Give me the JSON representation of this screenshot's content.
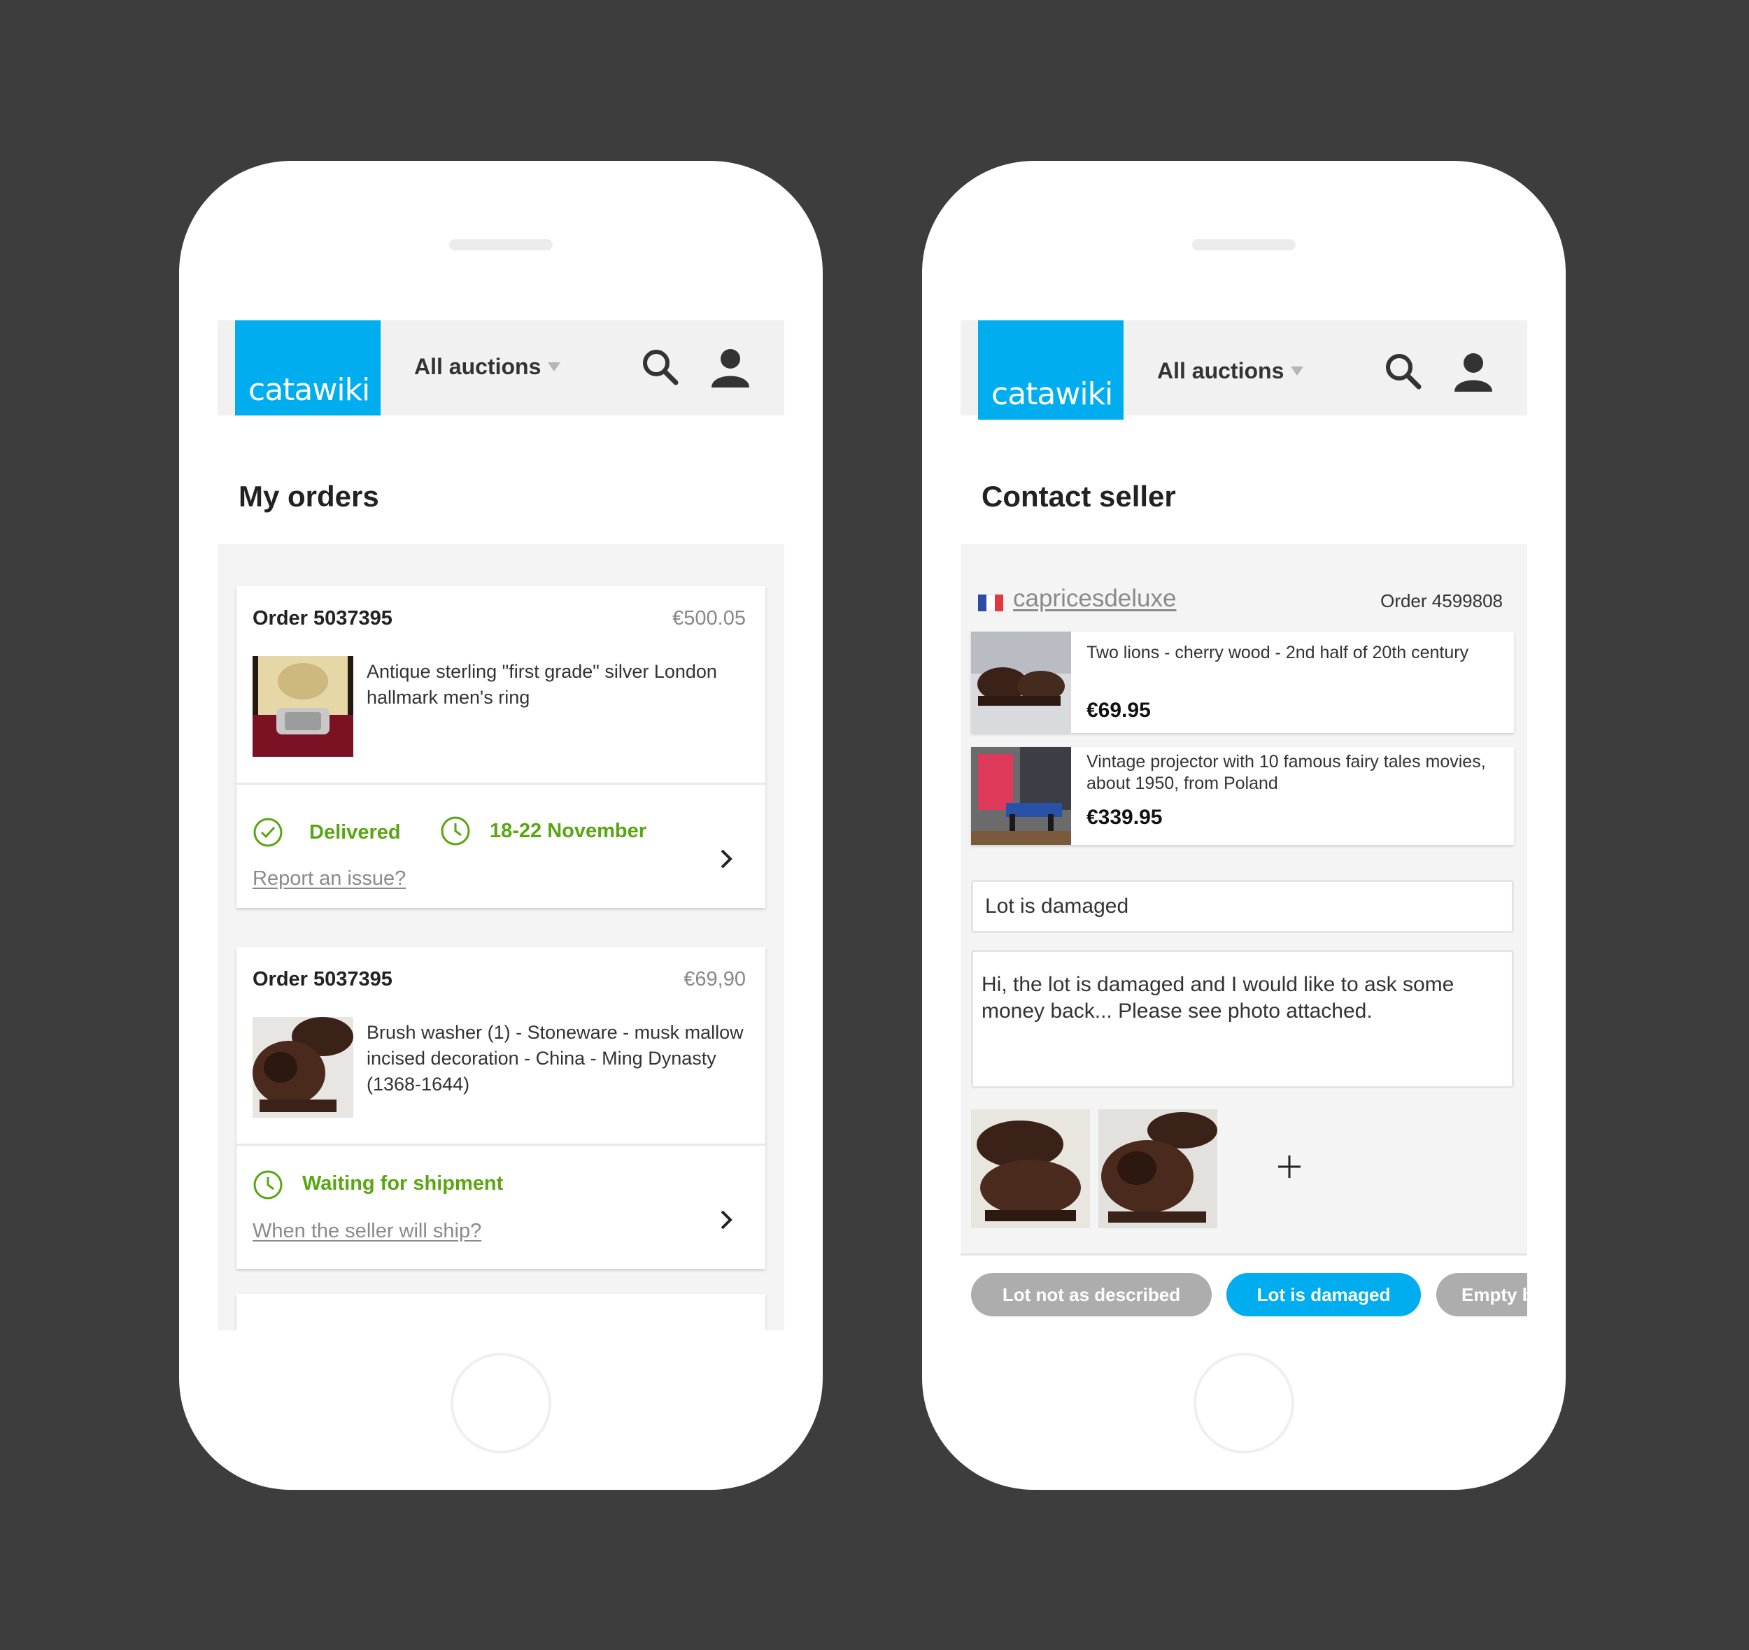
{
  "brand": {
    "logo_text": "catawiki",
    "color": "#00aeef"
  },
  "nav": {
    "auctions_label": "All auctions",
    "search_icon": "search-icon",
    "user_icon": "user-icon"
  },
  "orders_screen": {
    "title": "My orders",
    "orders": [
      {
        "order_label": "Order 5037395",
        "price": "€500.05",
        "description": "Antique sterling \"first grade\" silver London hallmark men's ring",
        "status": "Delivered",
        "date": "18-22 November",
        "link": "Report an issue?"
      },
      {
        "order_label": "Order 5037395",
        "price": "€69,90",
        "description": "Brush washer (1) - Stoneware - musk mallow incised decoration - China - Ming Dynasty (1368-1644)",
        "status": "Waiting for shipment",
        "link": "When the seller will ship?"
      }
    ]
  },
  "contact_screen": {
    "title": "Contact seller",
    "seller": "capricesdeluxe",
    "order_label": "Order 4599808",
    "lots": [
      {
        "title": "Two lions - cherry wood - 2nd half of 20th century",
        "price": "€69.95"
      },
      {
        "title": "Vintage projector with 10 famous fairy tales movies, about 1950, from Poland",
        "price": "€339.95"
      }
    ],
    "subject": "Lot is damaged",
    "message": "Hi, the lot is damaged and I would like to ask some money back... Please see photo attached.",
    "chips": [
      "Lot not as described",
      "Lot is damaged",
      "Empty b"
    ]
  },
  "colors": {
    "status_green": "#5aa512",
    "chip_gray": "#adadad",
    "background": "#3d3d3d"
  }
}
